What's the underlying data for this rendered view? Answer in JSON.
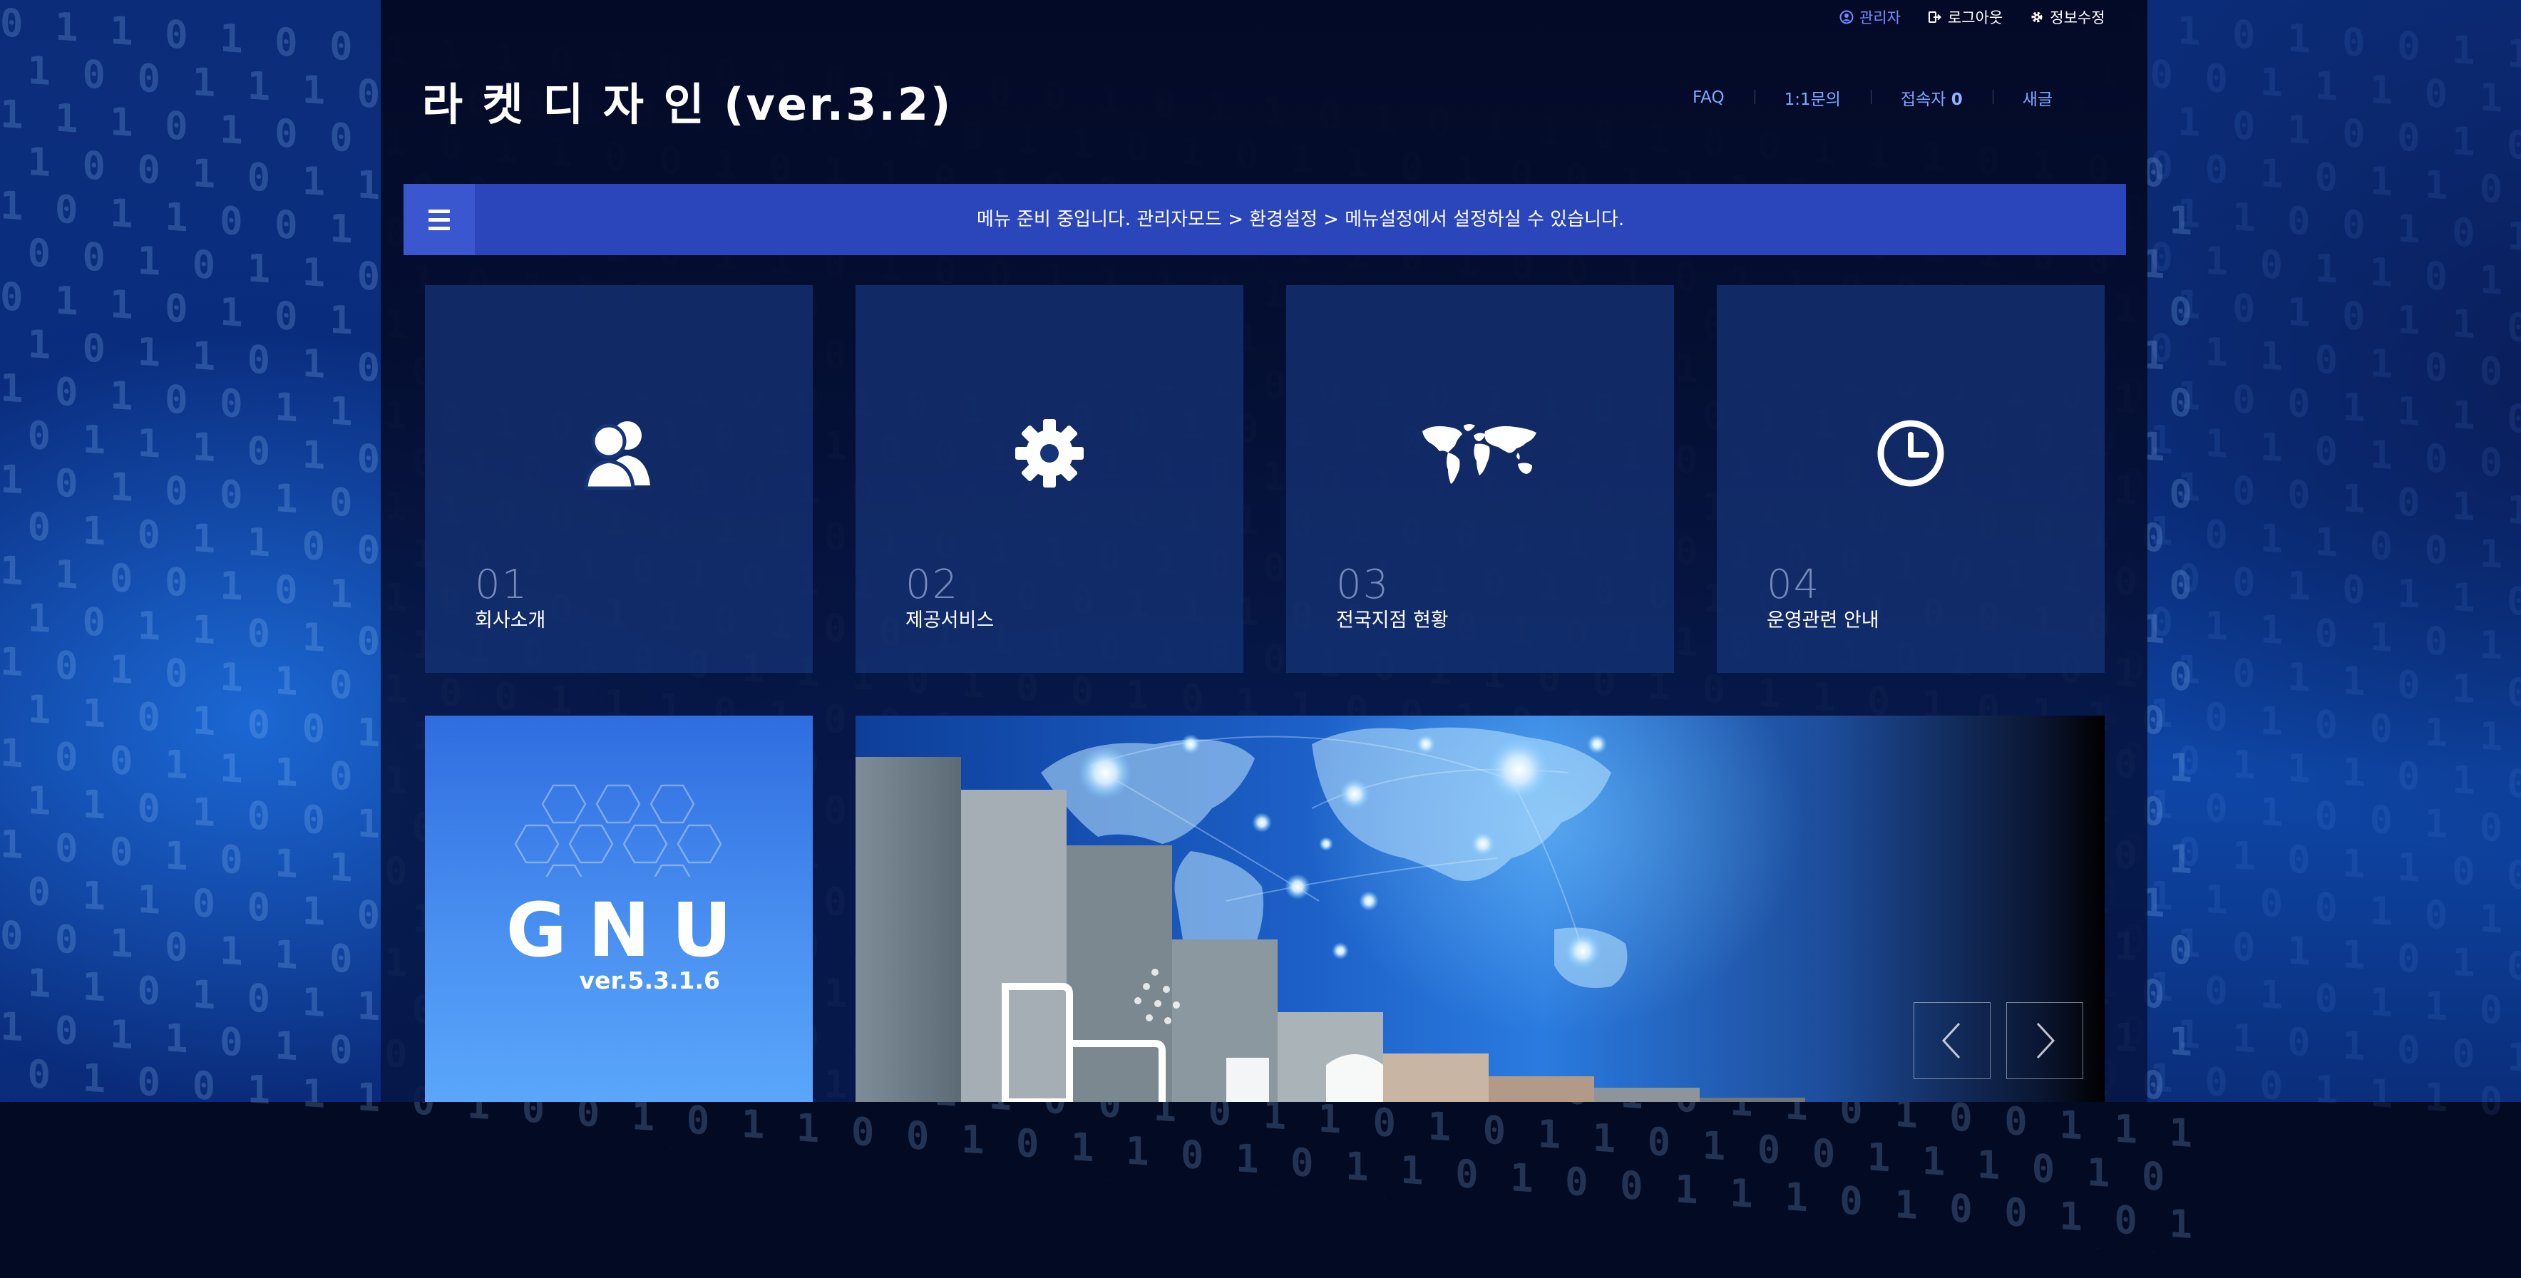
{
  "topbar": {
    "admin": "관리자",
    "logout": "로그아웃",
    "profile": "정보수정"
  },
  "logo": "라 켓 디 자 인 (ver.3.2)",
  "header_nav": {
    "faq": "FAQ",
    "qa": "1:1문의",
    "visitors_label": "접속자",
    "visitors_count": "0",
    "new_posts": "새글"
  },
  "menubar": {
    "message": "메뉴 준비 중입니다. 관리자모드 > 환경설정 > 메뉴설정에서 설정하실 수 있습니다."
  },
  "tiles": [
    {
      "num": "01",
      "label": "회사소개",
      "icon": "users-icon"
    },
    {
      "num": "02",
      "label": "제공서비스",
      "icon": "gear-icon"
    },
    {
      "num": "03",
      "label": "전국지점 현황",
      "icon": "world-map-icon"
    },
    {
      "num": "04",
      "label": "운영관련 안내",
      "icon": "clock-icon"
    }
  ],
  "gnu": {
    "title": "GNU",
    "version": "ver.5.3.1.6"
  },
  "colors": {
    "menubar": "#2b46bb",
    "admin_link": "#6f8dff",
    "nav_link": "#7fa8ff",
    "gnu_box": "#4b92f2"
  }
}
